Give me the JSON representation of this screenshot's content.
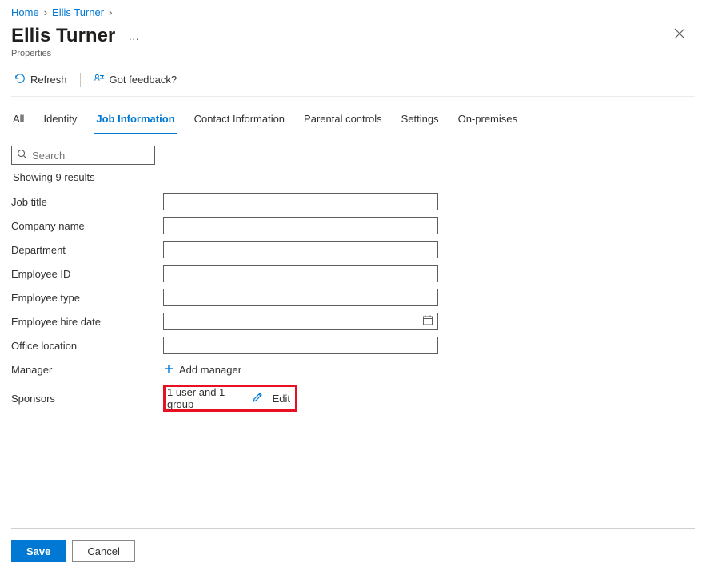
{
  "breadcrumb": {
    "home": "Home",
    "user": "Ellis Turner"
  },
  "page": {
    "title": "Ellis Turner",
    "subtitle": "Properties"
  },
  "toolbar": {
    "refresh_label": "Refresh",
    "feedback_label": "Got feedback?"
  },
  "tabs": {
    "all": "All",
    "identity": "Identity",
    "job": "Job Information",
    "contact": "Contact Information",
    "parental": "Parental controls",
    "settings": "Settings",
    "onprem": "On-premises"
  },
  "search": {
    "placeholder": "Search",
    "result_text": "Showing 9 results"
  },
  "fields": {
    "job_title": "Job title",
    "company_name": "Company name",
    "department": "Department",
    "employee_id": "Employee ID",
    "employee_type": "Employee type",
    "employee_hire_date": "Employee hire date",
    "office_location": "Office location",
    "manager": "Manager",
    "sponsors": "Sponsors"
  },
  "values": {
    "job_title": "",
    "company_name": "",
    "department": "",
    "employee_id": "",
    "employee_type": "",
    "employee_hire_date": "",
    "office_location": ""
  },
  "manager_action": {
    "add_label": "Add manager"
  },
  "sponsors": {
    "summary": "1 user and 1 group",
    "edit_label": "Edit"
  },
  "footer": {
    "save_label": "Save",
    "cancel_label": "Cancel"
  }
}
